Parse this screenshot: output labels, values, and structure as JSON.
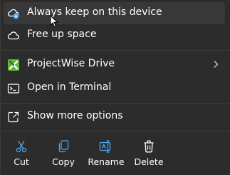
{
  "menu": {
    "items": [
      {
        "label": "Always keep on this device",
        "icon": "cloud-sync-icon"
      },
      {
        "label": "Free up space",
        "icon": "cloud-icon"
      },
      {
        "label": "ProjectWise Drive",
        "icon": "projectwise-icon",
        "has_submenu": true
      },
      {
        "label": "Open in Terminal",
        "icon": "terminal-icon"
      },
      {
        "label": "Show more options",
        "icon": "share-external-icon"
      }
    ],
    "actions": [
      {
        "label": "Cut",
        "icon": "scissors-icon"
      },
      {
        "label": "Copy",
        "icon": "copy-icon"
      },
      {
        "label": "Rename",
        "icon": "rename-icon"
      },
      {
        "label": "Delete",
        "icon": "trash-icon"
      }
    ]
  },
  "colors": {
    "background": "#2c2c2c",
    "hover": "#383838",
    "text": "#ffffff",
    "accent_blue": "#4ea8f5",
    "projectwise_green": "#5fb83a"
  }
}
